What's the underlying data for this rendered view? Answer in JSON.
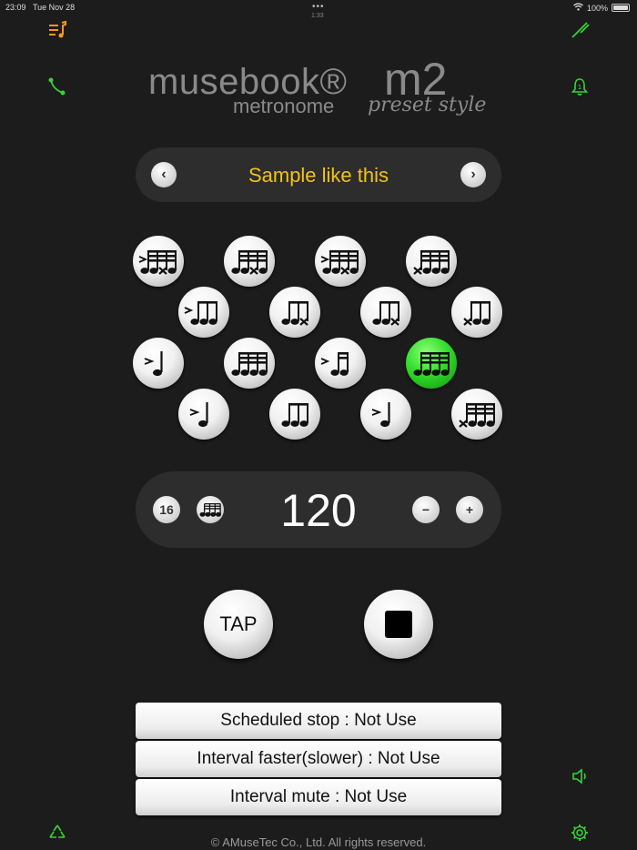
{
  "status_bar": {
    "time": "23:09",
    "date": "Tue Nov 28",
    "dots": "•••",
    "sub": "1:33",
    "wifi": "wifi",
    "battery_text": "100%",
    "battery_level": 1.0
  },
  "icons": {
    "top_left": "playlist-icon",
    "left_second": "curve-icon",
    "top_right": "tuning-fork-icon",
    "right_second": "bell-icon",
    "right_lower": "speaker-icon",
    "bottom_left": "recycle-icon",
    "bottom_right": "gear-icon"
  },
  "colors": {
    "accent_green": "#3ad23a",
    "title_yellow": "#f2c21b",
    "icon_orange": "#f29a1e"
  },
  "logo": {
    "brand": "musebook®",
    "product": "metronome",
    "model": "m2",
    "style": "preset style"
  },
  "preset": {
    "title": "Sample like this",
    "prev": "‹",
    "next": "›"
  },
  "patterns": [
    {
      "glyph": "sixteenths-accent-x"
    },
    {
      "glyph": "sixteenths-x"
    },
    {
      "glyph": "sixteenths-accent-x"
    },
    {
      "glyph": "sixteenths-x-first"
    },
    {
      "glyph": "triplet-accent"
    },
    {
      "glyph": "triplet-x"
    },
    {
      "glyph": "triplet-x"
    },
    {
      "glyph": "triplet-x-first"
    },
    {
      "glyph": "quarter-accent"
    },
    {
      "glyph": "sixteenths"
    },
    {
      "glyph": "eighths-accent"
    },
    {
      "glyph": "sixteenths",
      "active": true
    },
    {
      "glyph": "quarter-accent"
    },
    {
      "glyph": "triplet"
    },
    {
      "glyph": "quarter-accent"
    },
    {
      "glyph": "sixteenths-x-first"
    }
  ],
  "tempo": {
    "subdivision": "16",
    "bpm": "120",
    "minus": "−",
    "plus": "+"
  },
  "controls": {
    "tap_label": "TAP"
  },
  "options": [
    "Scheduled stop : Not Use",
    "Interval faster(slower) : Not Use",
    "Interval mute : Not Use"
  ],
  "footer": {
    "copyright": "© AMuseTec Co., Ltd. All rights reserved."
  }
}
